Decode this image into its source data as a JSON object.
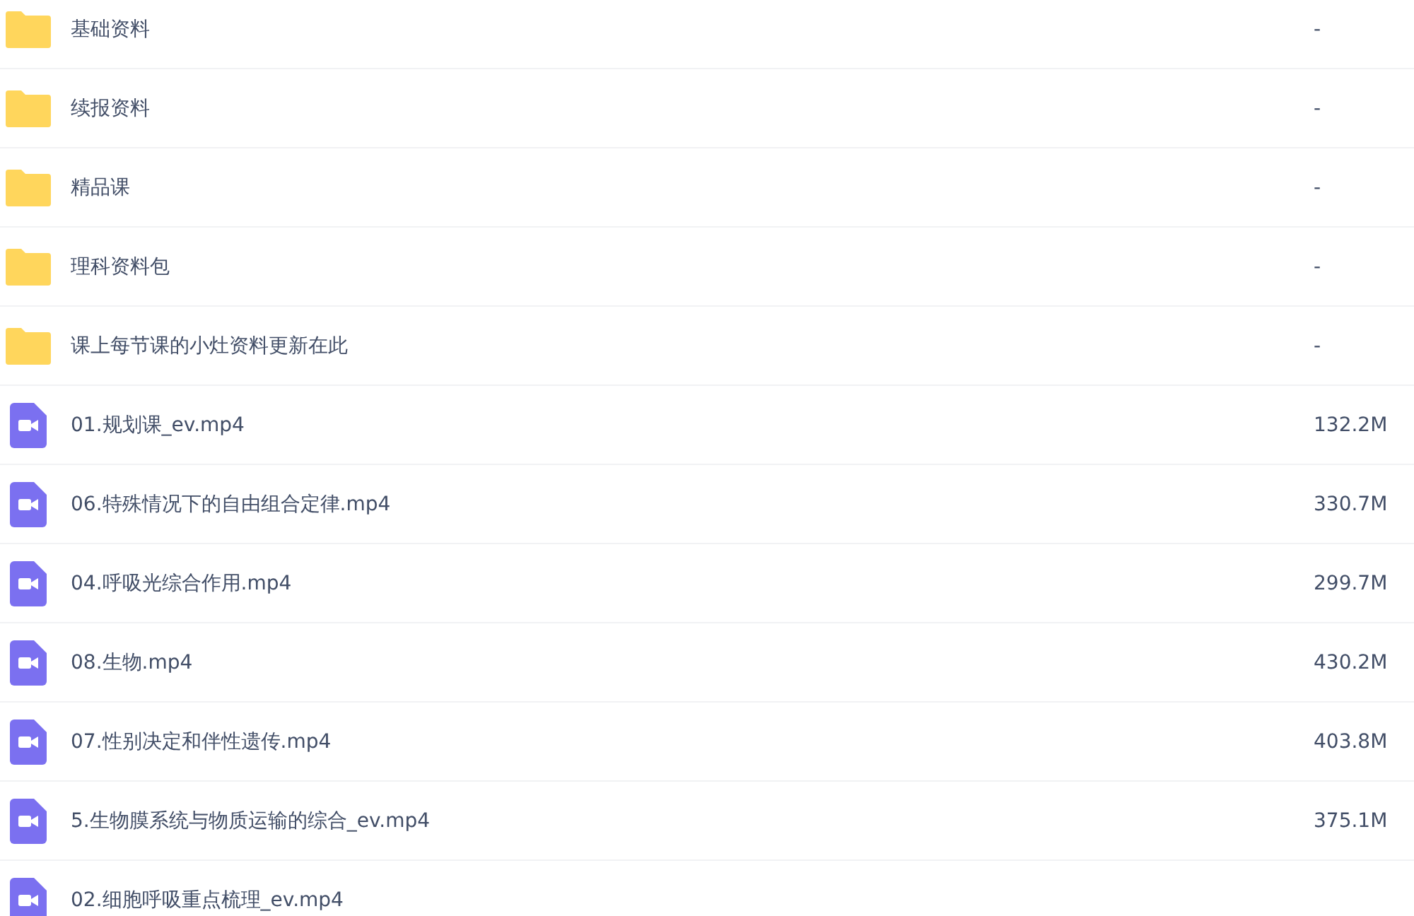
{
  "files": [
    {
      "kind": "folder",
      "name": "基础资料",
      "size": "-"
    },
    {
      "kind": "folder",
      "name": "续报资料",
      "size": "-"
    },
    {
      "kind": "folder",
      "name": "精品课",
      "size": "-"
    },
    {
      "kind": "folder",
      "name": "理科资料包",
      "size": "-"
    },
    {
      "kind": "folder",
      "name": "课上每节课的小灶资料更新在此",
      "size": "-"
    },
    {
      "kind": "video",
      "name": "01.规划课_ev.mp4",
      "size": "132.2M"
    },
    {
      "kind": "video",
      "name": "06.特殊情况下的自由组合定律.mp4",
      "size": "330.7M"
    },
    {
      "kind": "video",
      "name": "04.呼吸光综合作用.mp4",
      "size": "299.7M"
    },
    {
      "kind": "video",
      "name": "08.生物.mp4",
      "size": "430.2M"
    },
    {
      "kind": "video",
      "name": "07.性别决定和伴性遗传.mp4",
      "size": "403.8M"
    },
    {
      "kind": "video",
      "name": "5.生物膜系统与物质运输的综合_ev.mp4",
      "size": "375.1M"
    },
    {
      "kind": "video",
      "name": "02.细胞呼吸重点梳理_ev.mp4"
    }
  ]
}
